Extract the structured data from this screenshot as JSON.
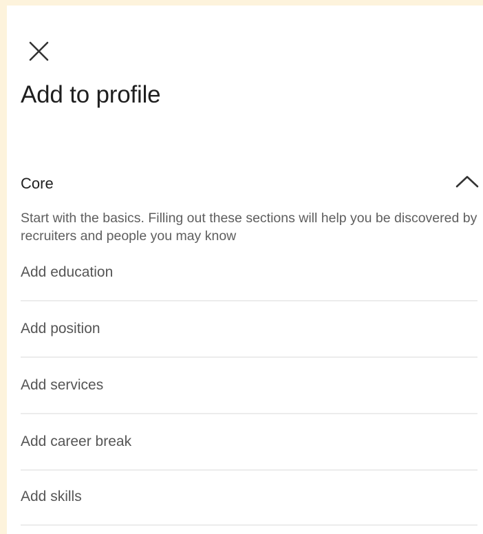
{
  "header": {
    "title": "Add to profile"
  },
  "icons": {
    "close": "close-icon",
    "collapse": "chevron-up-icon"
  },
  "section": {
    "title": "Core",
    "description": "Start with the basics. Filling out these sections will help you be discovered by recruiters and people you may know",
    "items": [
      {
        "label": "Add education"
      },
      {
        "label": "Add position"
      },
      {
        "label": "Add services"
      },
      {
        "label": "Add career break"
      },
      {
        "label": "Add skills"
      }
    ]
  },
  "colors": {
    "page_background": "#fdf3dc",
    "panel_background": "#ffffff",
    "title_text": "#1f1f1f",
    "item_text": "#555555",
    "divider": "#ececec"
  }
}
